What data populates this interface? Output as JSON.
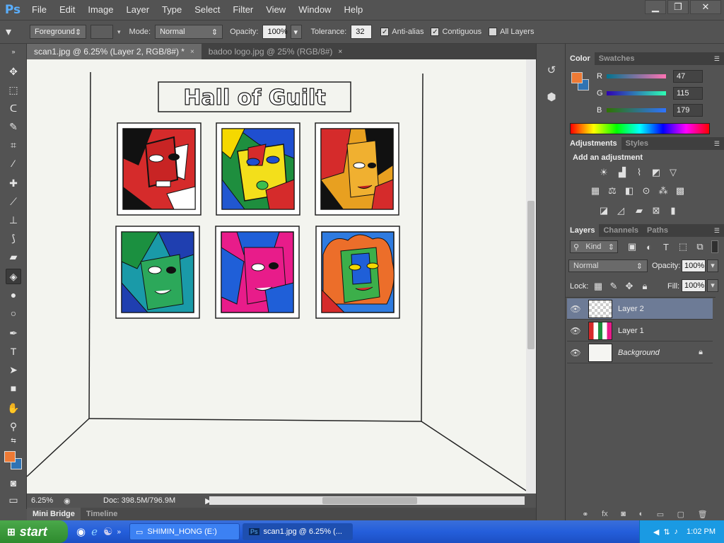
{
  "app": {
    "logo": "Ps"
  },
  "menu": [
    "File",
    "Edit",
    "Image",
    "Layer",
    "Type",
    "Select",
    "Filter",
    "View",
    "Window",
    "Help"
  ],
  "window_controls": {
    "minimize": "▁",
    "restore": "❐",
    "close": "✕"
  },
  "options": {
    "fill_source": "Foreground",
    "mode_label": "Mode:",
    "mode_value": "Normal",
    "opacity_label": "Opacity:",
    "opacity_value": "100%",
    "tolerance_label": "Tolerance:",
    "tolerance_value": "32",
    "antialias_label": "Anti-alias",
    "antialias_checked": true,
    "contiguous_label": "Contiguous",
    "contiguous_checked": true,
    "all_layers_label": "All Layers",
    "all_layers_checked": false
  },
  "tabs": [
    {
      "label": "scan1.jpg @ 6.25% (Layer 2, RGB/8#) *",
      "close": "×"
    },
    {
      "label": "badoo logo.jpg @ 25% (RGB/8#)",
      "close": "×"
    }
  ],
  "artwork": {
    "title": "Hall of Guilt"
  },
  "status": {
    "zoom": "6.25%",
    "doc": "Doc: 398.5M/796.9M"
  },
  "bottom_tabs": [
    "Mini Bridge",
    "Timeline"
  ],
  "color_panel": {
    "tabs": [
      "Color",
      "Swatches"
    ],
    "r_label": "R",
    "r": "47",
    "g_label": "G",
    "g": "115",
    "b_label": "B",
    "b": "179",
    "foreground": "#ee7a35",
    "background": "#2f73b3"
  },
  "adjustments": {
    "tabs": [
      "Adjustments",
      "Styles"
    ],
    "heading": "Add an adjustment"
  },
  "layers_panel": {
    "tabs": [
      "Layers",
      "Channels",
      "Paths"
    ],
    "filter": "Kind",
    "blend_mode": "Normal",
    "opacity_label": "Opacity:",
    "opacity_value": "100%",
    "lock_label": "Lock:",
    "fill_label": "Fill:",
    "fill_value": "100%",
    "layers": [
      {
        "name": "Layer 2"
      },
      {
        "name": "Layer 1"
      },
      {
        "name": "Background"
      }
    ]
  },
  "taskbar": {
    "start": "start",
    "tasks": [
      "SHIMIN_HONG (E:)",
      "scan1.jpg @ 6.25% (..."
    ],
    "time": "1:02 PM"
  }
}
